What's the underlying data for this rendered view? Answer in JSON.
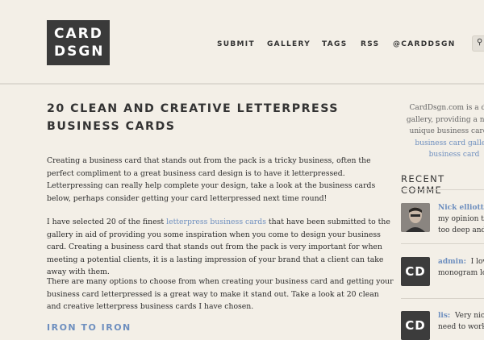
{
  "logo": {
    "line1": "CARD",
    "line2": "DSGN"
  },
  "nav": {
    "submit": "SUBMIT",
    "gallery": "GALLERY",
    "tags": "TAGS",
    "rss": "RSS",
    "twitter": "@CARDDSGN"
  },
  "search": {
    "icon": "search-icon",
    "glyph": "⚲"
  },
  "article": {
    "title": "20 CLEAN AND CREATIVE LETTERPRESS BUSINESS CARDS",
    "p1": "Creating a business card that stands out from the pack is a tricky business, often the perfect compliment to a great business card design is to have it letterpressed. Letterpressing can really help complete your design, take a look at the business cards below, perhaps consider getting your card letterpressed next time round!",
    "p2_before": "I have selected 20 of the finest ",
    "p2_link": "letterpress business cards",
    "p2_after": " that have been submitted to the gallery in aid of providing you some inspiration when you come to design your business card. Creating a business card that stands out from the pack is very important for when meeting a potential clients, it is a lasting impression of your brand that a client can take away with them.",
    "p3": "There are many options to choose from when creating your business card and getting your business card letterpressed is a great way to make it stand out. Take a look at 20 clean and creative letterpress business cards I have chosen.",
    "subhead": "IRON TO IRON"
  },
  "sidebar": {
    "intro_l1": "CardDsgn.com is a daily",
    "intro_l2": "gallery, providing a new b",
    "intro_l3": "unique business card de",
    "intro_l4": "business card gallery",
    "intro_l5": "business card",
    "recent_heading": "RECENT COMME",
    "comments": [
      {
        "author": "Nick elliott:",
        "l1": "my opinion th",
        "l2": "too deep and"
      },
      {
        "author": "admin:",
        "l1": "I lov",
        "l2": "monogram lo",
        "avatar": "CD"
      },
      {
        "author": "lis:",
        "l1": "Very nic",
        "l2": "need to work",
        "avatar": "CD"
      }
    ]
  }
}
